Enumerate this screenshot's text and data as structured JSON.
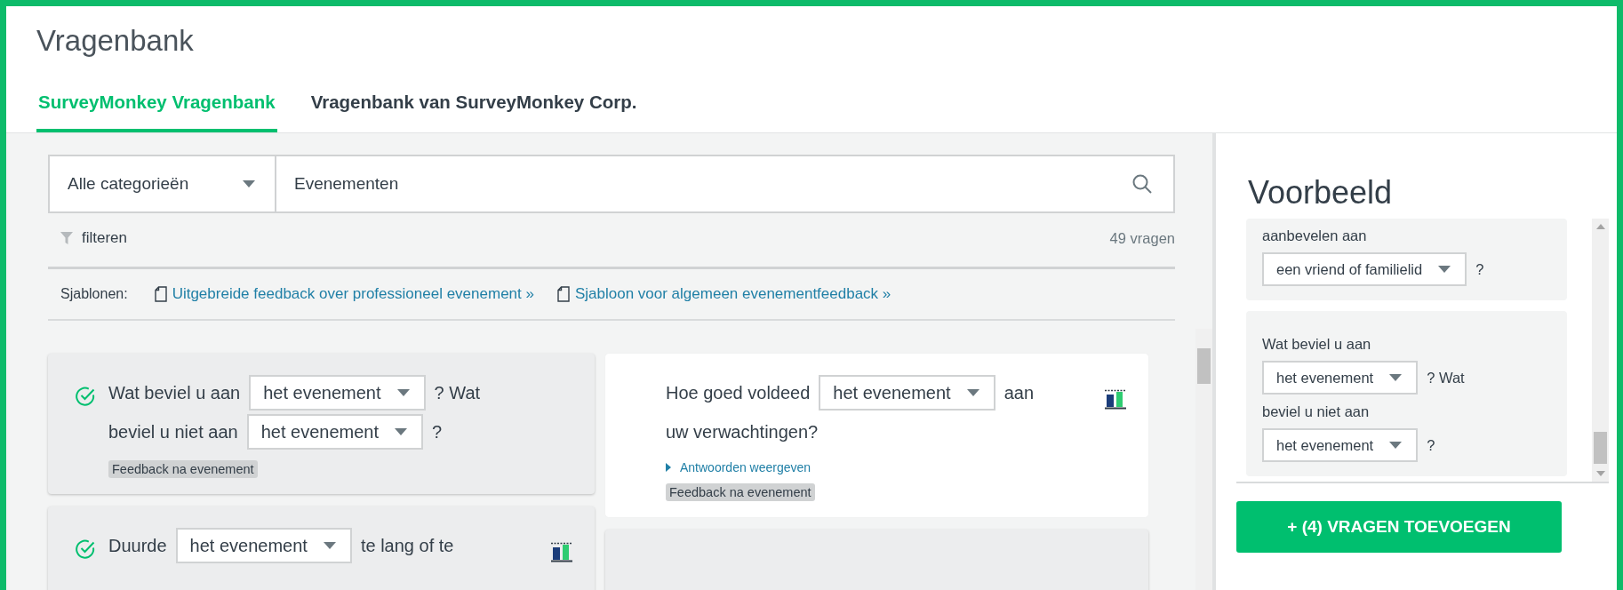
{
  "header": {
    "title": "Vragenbank"
  },
  "tabs": [
    {
      "label": "SurveyMonkey Vragenbank",
      "selected": true
    },
    {
      "label": "Vragenbank van SurveyMonkey Corp.",
      "selected": false
    }
  ],
  "search": {
    "category": "Alle categorieën",
    "value": "Evenementen"
  },
  "filter": {
    "label": "filteren",
    "count": "49 vragen"
  },
  "templates": {
    "label": "Sjablonen:",
    "links": [
      "Uitgebreide feedback over professioneel evenement »",
      "Sjabloon voor algemeen evenementfeedback »"
    ]
  },
  "columns": [
    [
      {
        "checked": true,
        "selected": true,
        "has_chart": false,
        "lines": [
          [
            {
              "kind": "text",
              "text": "Wat beviel u aan"
            },
            {
              "kind": "select",
              "value": "het evenement"
            },
            {
              "kind": "text",
              "text": "? Wat"
            }
          ],
          [
            {
              "kind": "text",
              "text": "beviel u niet aan"
            },
            {
              "kind": "select",
              "value": "het evenement"
            },
            {
              "kind": "text",
              "text": "?"
            }
          ]
        ],
        "tag": "Feedback na evenement"
      },
      {
        "checked": true,
        "selected": true,
        "has_chart": true,
        "lines": [
          [
            {
              "kind": "text",
              "text": "Duurde"
            },
            {
              "kind": "select",
              "value": "het evenement"
            },
            {
              "kind": "text",
              "text": "te lang of te"
            }
          ]
        ]
      }
    ],
    [
      {
        "checked": false,
        "selected": false,
        "has_chart": true,
        "lines": [
          [
            {
              "kind": "text",
              "text": "Hoe goed voldeed"
            },
            {
              "kind": "select",
              "value": "het evenement"
            },
            {
              "kind": "text",
              "text": "aan"
            }
          ],
          [
            {
              "kind": "text",
              "text": "uw verwachtingen?"
            }
          ]
        ],
        "link": "Antwoorden weergeven",
        "tag": "Feedback na evenement"
      },
      {
        "checked": false,
        "selected": true,
        "has_chart": false
      }
    ]
  ],
  "preview": {
    "title": "Voorbeeld",
    "questions": [
      {
        "lines": [
          [
            {
              "kind": "text",
              "text": "aanbevelen aan"
            }
          ],
          [
            {
              "kind": "select",
              "value": "een vriend of familielid"
            },
            {
              "kind": "text",
              "text": "?"
            }
          ]
        ]
      },
      {
        "lines": [
          [
            {
              "kind": "text",
              "text": "Wat beviel u aan"
            }
          ],
          [
            {
              "kind": "select",
              "value": "het evenement"
            },
            {
              "kind": "text",
              "text": "? Wat"
            }
          ],
          [
            {
              "kind": "text",
              "text": "beviel u niet aan"
            }
          ],
          [
            {
              "kind": "select",
              "value": "het evenement"
            },
            {
              "kind": "text",
              "text": "?"
            }
          ]
        ]
      }
    ]
  },
  "add_button": "+ (4) VRAGEN TOEVOEGEN"
}
